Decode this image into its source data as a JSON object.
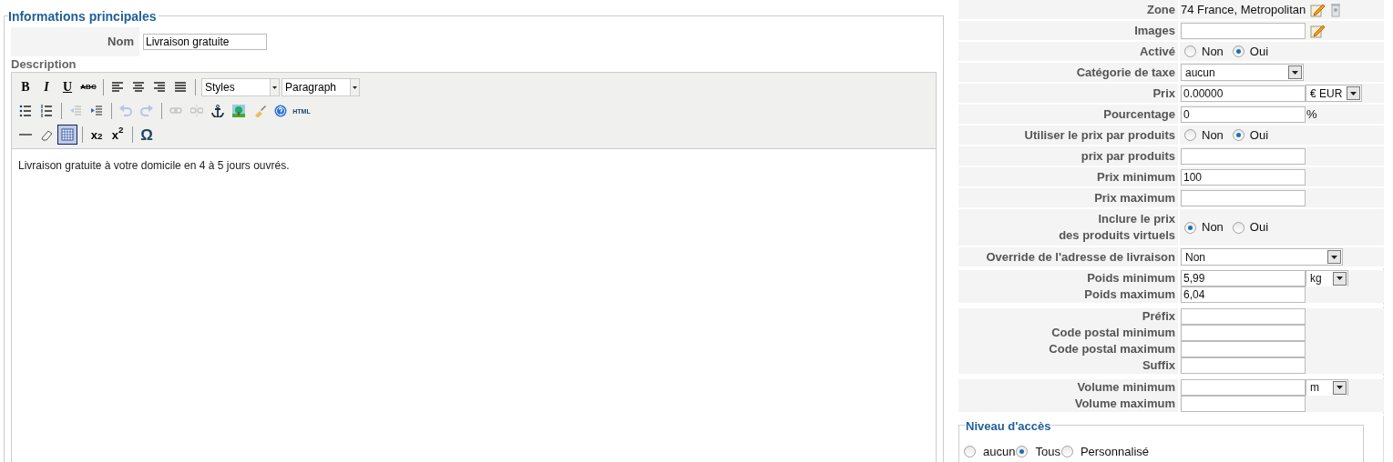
{
  "main": {
    "legend": "Informations principales",
    "name_label": "Nom",
    "name_value": "Livraison gratuite",
    "description_label": "Description",
    "toolbar": [
      [
        {
          "kind": "bold",
          "text": "B"
        },
        {
          "kind": "italic",
          "text": "I"
        },
        {
          "kind": "underline",
          "text": "U"
        },
        {
          "kind": "strike",
          "text": "ABC"
        },
        {
          "kind": "sep"
        },
        {
          "kind": "align_left"
        },
        {
          "kind": "align_center"
        },
        {
          "kind": "align_right"
        },
        {
          "kind": "align_justify"
        },
        {
          "kind": "sep"
        },
        {
          "kind": "select",
          "text": "Styles"
        },
        {
          "kind": "select",
          "text": "Paragraph"
        }
      ],
      [
        {
          "kind": "bullets"
        },
        {
          "kind": "numbers"
        },
        {
          "kind": "sep"
        },
        {
          "kind": "outdent",
          "disabled": true
        },
        {
          "kind": "indent",
          "disabled": false
        },
        {
          "kind": "sep"
        },
        {
          "kind": "undo",
          "disabled": true
        },
        {
          "kind": "redo",
          "disabled": true
        },
        {
          "kind": "sep"
        },
        {
          "kind": "link",
          "disabled": true
        },
        {
          "kind": "unlink",
          "disabled": true
        },
        {
          "kind": "anchor"
        },
        {
          "kind": "image"
        },
        {
          "kind": "brush"
        },
        {
          "kind": "help"
        },
        {
          "kind": "html",
          "text": "HTML"
        }
      ],
      [
        {
          "kind": "rule"
        },
        {
          "kind": "eraser"
        },
        {
          "kind": "table",
          "selected": true
        },
        {
          "kind": "sep"
        },
        {
          "kind": "script",
          "text": "x$_{2}$"
        },
        {
          "kind": "script",
          "text": "x$^{2}$"
        },
        {
          "kind": "sep"
        },
        {
          "kind": "glyph",
          "text": "Ω"
        }
      ]
    ],
    "content": "Livraison gratuite à votre domicile en 4 à 5 jours ouvrés."
  },
  "settings": [
    [
      {
        "label": "Zone",
        "kind": "text",
        "value": "74 France, Metropolitan"
      }
    ],
    [
      {
        "label": "Images",
        "kind": "input_edit"
      }
    ],
    [
      {
        "label": "Activé",
        "kind": "radio",
        "options": [
          {
            "label": "Non",
            "selected": false
          },
          {
            "label": "Oui",
            "selected": true
          }
        ]
      }
    ],
    [
      {
        "label": "Catégorie de taxe",
        "kind": "select",
        "value": "aucun"
      }
    ],
    [
      {
        "label": "Prix",
        "kind": "input_unit",
        "value": "0.00000",
        "unit": "€ EUR"
      }
    ],
    [
      {
        "label": "Pourcentage",
        "kind": "input_suffix",
        "value": "0",
        "suffix": "%"
      }
    ],
    [
      {
        "label": "Utiliser le prix par produits",
        "kind": "radio",
        "options": [
          {
            "label": "Non",
            "selected": false
          },
          {
            "label": "Oui",
            "selected": true
          }
        ]
      }
    ],
    [
      {
        "label": "prix par produits",
        "kind": "input"
      }
    ],
    [
      {
        "label": "Prix minimum",
        "kind": "input",
        "value": "100"
      }
    ],
    [
      {
        "label": "Prix maximum",
        "kind": "input"
      }
    ],
    [
      {
        "label": "Inclure le prix\ndes produits virtuels",
        "kind": "radio",
        "options": [
          {
            "label": "Non",
            "selected": true
          },
          {
            "label": "Oui",
            "selected": false
          }
        ]
      }
    ],
    [
      {
        "label": "Override de l'adresse de livraison",
        "kind": "select_wide",
        "value": "Non"
      }
    ],
    [
      {
        "label": "Poids minimum",
        "kind": "input_unit",
        "value": "5,99",
        "unit": "kg"
      },
      {
        "label": "Poids maximum",
        "kind": "input",
        "value": "6,04"
      }
    ],
    [
      {
        "label": "Préfix",
        "kind": "input"
      },
      {
        "label": "Code postal minimum",
        "kind": "input"
      },
      {
        "label": "Code postal maximum",
        "kind": "input"
      },
      {
        "label": "Suffix",
        "kind": "input"
      }
    ],
    [
      {
        "label": "Volume minimum",
        "kind": "input_unit",
        "unit": "m"
      },
      {
        "label": "Volume maximum",
        "kind": "input"
      }
    ]
  ],
  "access": {
    "legend": "Niveau d'accès",
    "options": [
      {
        "label": "aucun",
        "selected": false
      },
      {
        "label": "Tous",
        "selected": true
      },
      {
        "label": "Personnalisé",
        "selected": false
      }
    ]
  }
}
